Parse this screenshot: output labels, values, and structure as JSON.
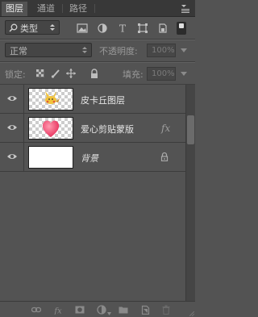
{
  "tabs": [
    {
      "label": "图层"
    },
    {
      "label": "通道"
    },
    {
      "label": "路径"
    }
  ],
  "filter": {
    "kind_label": "类型"
  },
  "blend": {
    "mode": "正常",
    "opacity_label": "不透明度:",
    "opacity_value": "100%"
  },
  "lock": {
    "label": "锁定:",
    "fill_label": "填充:",
    "fill_value": "100%"
  },
  "layers": [
    {
      "name": "皮卡丘图层",
      "visible": true
    },
    {
      "name": "爱心剪贴蒙版",
      "visible": true,
      "fx": "fx"
    },
    {
      "name": "背景",
      "visible": true,
      "locked": true
    }
  ],
  "colors": {
    "panel": "#535353",
    "tabbar": "#383838",
    "heart": "#e8466a"
  }
}
